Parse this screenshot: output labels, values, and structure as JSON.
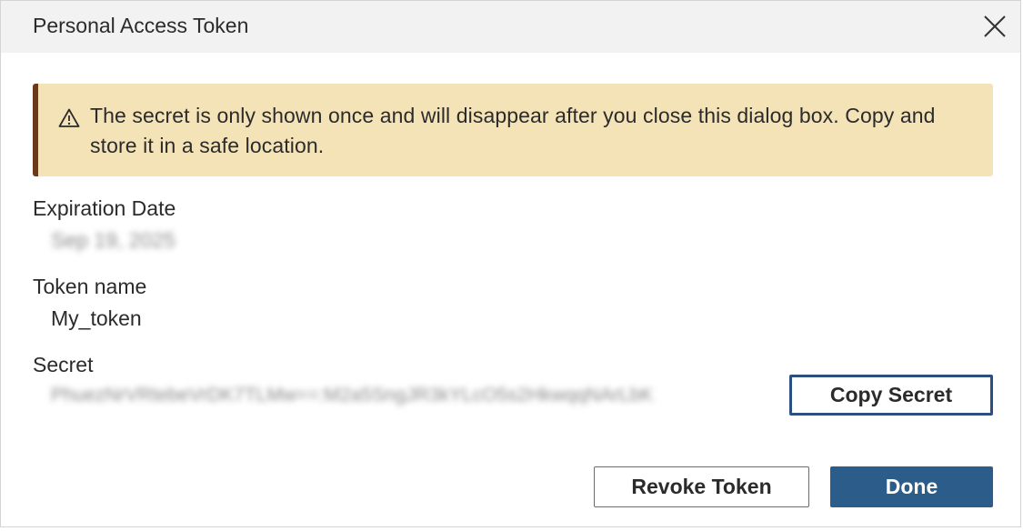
{
  "dialog": {
    "title": "Personal Access Token",
    "close_icon": "close-icon"
  },
  "warning": {
    "icon": "warning-triangle-icon",
    "text": "The secret is only shown once and will disappear after you close this dialog box. Copy and store it in a safe location."
  },
  "fields": {
    "expiration_label": "Expiration Date",
    "expiration_value": "Sep 19, 2025",
    "token_name_label": "Token name",
    "token_name_value": "My_token",
    "secret_label": "Secret",
    "secret_value": "PhuezNrVRtebeVrDK7TLMw==:M2a5SngJR3kYLcO5s2HkwqqNArLbK"
  },
  "buttons": {
    "copy_secret": "Copy Secret",
    "revoke_token": "Revoke Token",
    "done": "Done"
  },
  "colors": {
    "warning_bg": "#f5e3b8",
    "warning_border": "#6b3a1a",
    "primary": "#2c5d8a",
    "focus_border": "#2b4f7e"
  }
}
